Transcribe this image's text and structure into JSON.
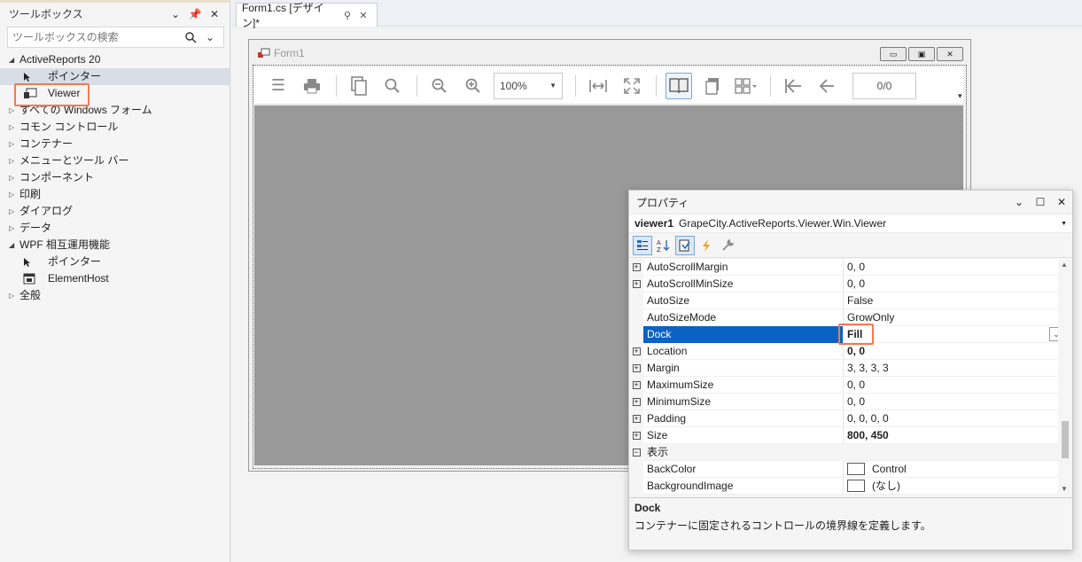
{
  "toolbox": {
    "title": "ツールボックス",
    "search_placeholder": "ツールボックスの検索",
    "groups": [
      {
        "label": "ActiveReports 20"
      },
      {
        "label": "ポインター"
      },
      {
        "label": "Viewer"
      },
      {
        "label": "すべての Windows フォーム"
      },
      {
        "label": "コモン コントロール"
      },
      {
        "label": "コンテナー"
      },
      {
        "label": "メニューとツール バー"
      },
      {
        "label": "コンポーネント"
      },
      {
        "label": "印刷"
      },
      {
        "label": "ダイアログ"
      },
      {
        "label": "データ"
      },
      {
        "label": "WPF 相互運用機能"
      },
      {
        "label": "ポインター"
      },
      {
        "label": "ElementHost"
      },
      {
        "label": "全般"
      }
    ]
  },
  "designer": {
    "tab_label": "Form1.cs [デザイン]*",
    "form_title": "Form1",
    "zoom_value": "100%",
    "page_indicator": "0/0"
  },
  "properties": {
    "title": "プロパティ",
    "object_name": "viewer1",
    "object_type": "GrapeCity.ActiveReports.Viewer.Win.Viewer",
    "rows": [
      {
        "name": "AutoScrollMargin",
        "value": "0, 0"
      },
      {
        "name": "AutoScrollMinSize",
        "value": "0, 0"
      },
      {
        "name": "AutoSize",
        "value": "False"
      },
      {
        "name": "AutoSizeMode",
        "value": "GrowOnly"
      },
      {
        "name": "Dock",
        "value": "Fill"
      },
      {
        "name": "Location",
        "value": "0, 0"
      },
      {
        "name": "Margin",
        "value": "3, 3, 3, 3"
      },
      {
        "name": "MaximumSize",
        "value": "0, 0"
      },
      {
        "name": "MinimumSize",
        "value": "0, 0"
      },
      {
        "name": "Padding",
        "value": "0, 0, 0, 0"
      },
      {
        "name": "Size",
        "value": "800, 450"
      },
      {
        "name": "表示",
        "value": ""
      },
      {
        "name": "BackColor",
        "value": "Control"
      },
      {
        "name": "BackgroundImage",
        "value": "(なし)"
      }
    ],
    "desc_title": "Dock",
    "desc_text": "コンテナーに固定されるコントロールの境界線を定義します。"
  }
}
